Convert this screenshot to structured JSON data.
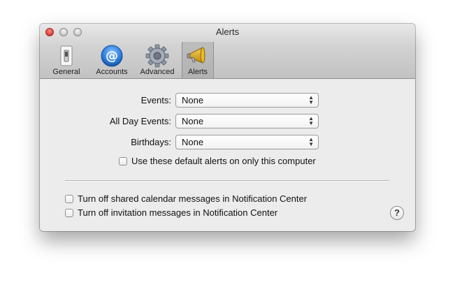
{
  "window": {
    "title": "Alerts"
  },
  "toolbar": {
    "items": [
      {
        "label": "General",
        "icon": "switch-icon"
      },
      {
        "label": "Accounts",
        "icon": "at-sign-icon"
      },
      {
        "label": "Advanced",
        "icon": "gear-icon"
      },
      {
        "label": "Alerts",
        "icon": "megaphone-icon",
        "selected": true
      }
    ]
  },
  "alerts": {
    "events": {
      "label": "Events:",
      "value": "None"
    },
    "all_day_events": {
      "label": "All Day Events:",
      "value": "None"
    },
    "birthdays": {
      "label": "Birthdays:",
      "value": "None"
    },
    "default_alerts_checkbox": {
      "label": "Use these default alerts on only this computer",
      "checked": false
    }
  },
  "notifications": {
    "shared_calendar_checkbox": {
      "label": "Turn off shared calendar messages in Notification Center",
      "checked": false
    },
    "invitation_checkbox": {
      "label": "Turn off invitation messages in Notification Center",
      "checked": false
    }
  },
  "help": {
    "label": "?"
  },
  "colors": {
    "close_button": "#e0443a",
    "accounts_icon_blue": "#2f7fe0",
    "alerts_icon_gold": "#d9a514"
  }
}
